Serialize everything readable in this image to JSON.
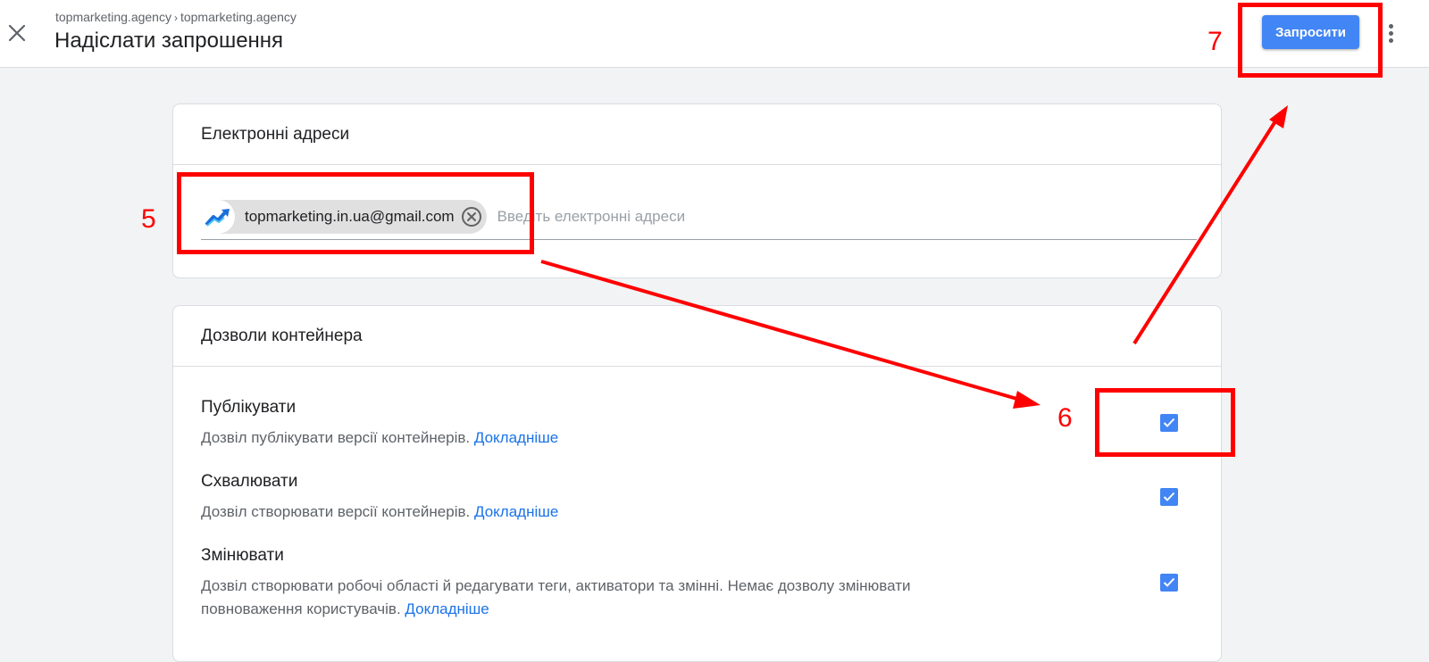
{
  "header": {
    "breadcrumb": [
      "topmarketing.agency",
      "topmarketing.agency"
    ],
    "breadcrumb_separator": "›",
    "title": "Надіслати запрошення",
    "invite_button_label": "Запросити"
  },
  "email_card": {
    "header": "Електронні адреси",
    "chip_email": "topmarketing.in.ua@gmail.com",
    "input_placeholder": "Введіть електронні адреси"
  },
  "permissions_card": {
    "header": "Дозволи контейнера",
    "items": [
      {
        "title": "Публікувати",
        "description": "Дозвіл публікувати версії контейнерів.",
        "link": "Докладніше",
        "checked": true
      },
      {
        "title": "Схвалювати",
        "description": "Дозвіл створювати версії контейнерів.",
        "link": "Докладніше",
        "checked": true
      },
      {
        "title": "Змінювати",
        "description": "Дозвіл створювати робочі області й редагувати теги, активатори та змінні. Немає дозволу змінювати повноваження користувачів.",
        "link": "Докладніше",
        "checked": true
      }
    ]
  },
  "annotations": {
    "step5": "5",
    "step6": "6",
    "step7": "7"
  },
  "colors": {
    "accent": "#4285f4",
    "link": "#1a73e8",
    "annotation": "#ff0000"
  }
}
